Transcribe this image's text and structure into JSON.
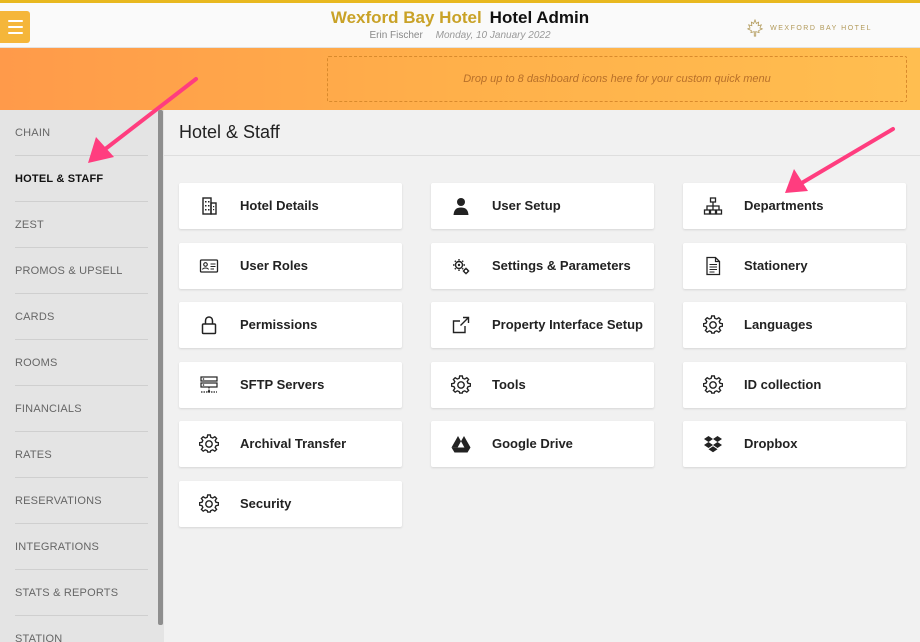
{
  "header": {
    "hotel_name": "Wexford Bay Hotel",
    "app_name": "Hotel Admin",
    "user": "Erin Fischer",
    "date": "Monday, 10 January 2022",
    "brand": "WEXFORD BAY HOTEL",
    "accent_color": "#c9a227"
  },
  "quick_menu": {
    "placeholder": "Drop up to 8 dashboard icons here for your custom quick menu"
  },
  "sidebar": {
    "items": [
      {
        "label": "CHAIN",
        "active": false
      },
      {
        "label": "HOTEL & STAFF",
        "active": true
      },
      {
        "label": "ZEST",
        "active": false
      },
      {
        "label": "PROMOS & UPSELL",
        "active": false
      },
      {
        "label": "CARDS",
        "active": false
      },
      {
        "label": "ROOMS",
        "active": false
      },
      {
        "label": "FINANCIALS",
        "active": false
      },
      {
        "label": "RATES",
        "active": false
      },
      {
        "label": "RESERVATIONS",
        "active": false
      },
      {
        "label": "INTEGRATIONS",
        "active": false
      },
      {
        "label": "STATS & REPORTS",
        "active": false
      },
      {
        "label": "STATION",
        "active": false
      }
    ]
  },
  "main": {
    "title": "Hotel & Staff",
    "tiles": [
      {
        "label": "Hotel Details",
        "icon": "building-icon"
      },
      {
        "label": "User Setup",
        "icon": "user-icon"
      },
      {
        "label": "Departments",
        "icon": "org-chart-icon"
      },
      {
        "label": "User Roles",
        "icon": "id-card-icon"
      },
      {
        "label": "Settings & Parameters",
        "icon": "gears-icon"
      },
      {
        "label": "Stationery",
        "icon": "document-icon"
      },
      {
        "label": "Permissions",
        "icon": "lock-icon"
      },
      {
        "label": "Property Interface Setup",
        "icon": "external-link-icon"
      },
      {
        "label": "Languages",
        "icon": "gear-icon"
      },
      {
        "label": "SFTP Servers",
        "icon": "server-icon"
      },
      {
        "label": "Tools",
        "icon": "gear-icon"
      },
      {
        "label": "ID collection",
        "icon": "gear-icon"
      },
      {
        "label": "Archival Transfer",
        "icon": "gear-icon"
      },
      {
        "label": "Google Drive",
        "icon": "google-drive-icon"
      },
      {
        "label": "Dropbox",
        "icon": "dropbox-icon"
      },
      {
        "label": "Security",
        "icon": "gear-icon"
      }
    ]
  },
  "annotation": {
    "arrow_color": "#ff3d7f"
  }
}
